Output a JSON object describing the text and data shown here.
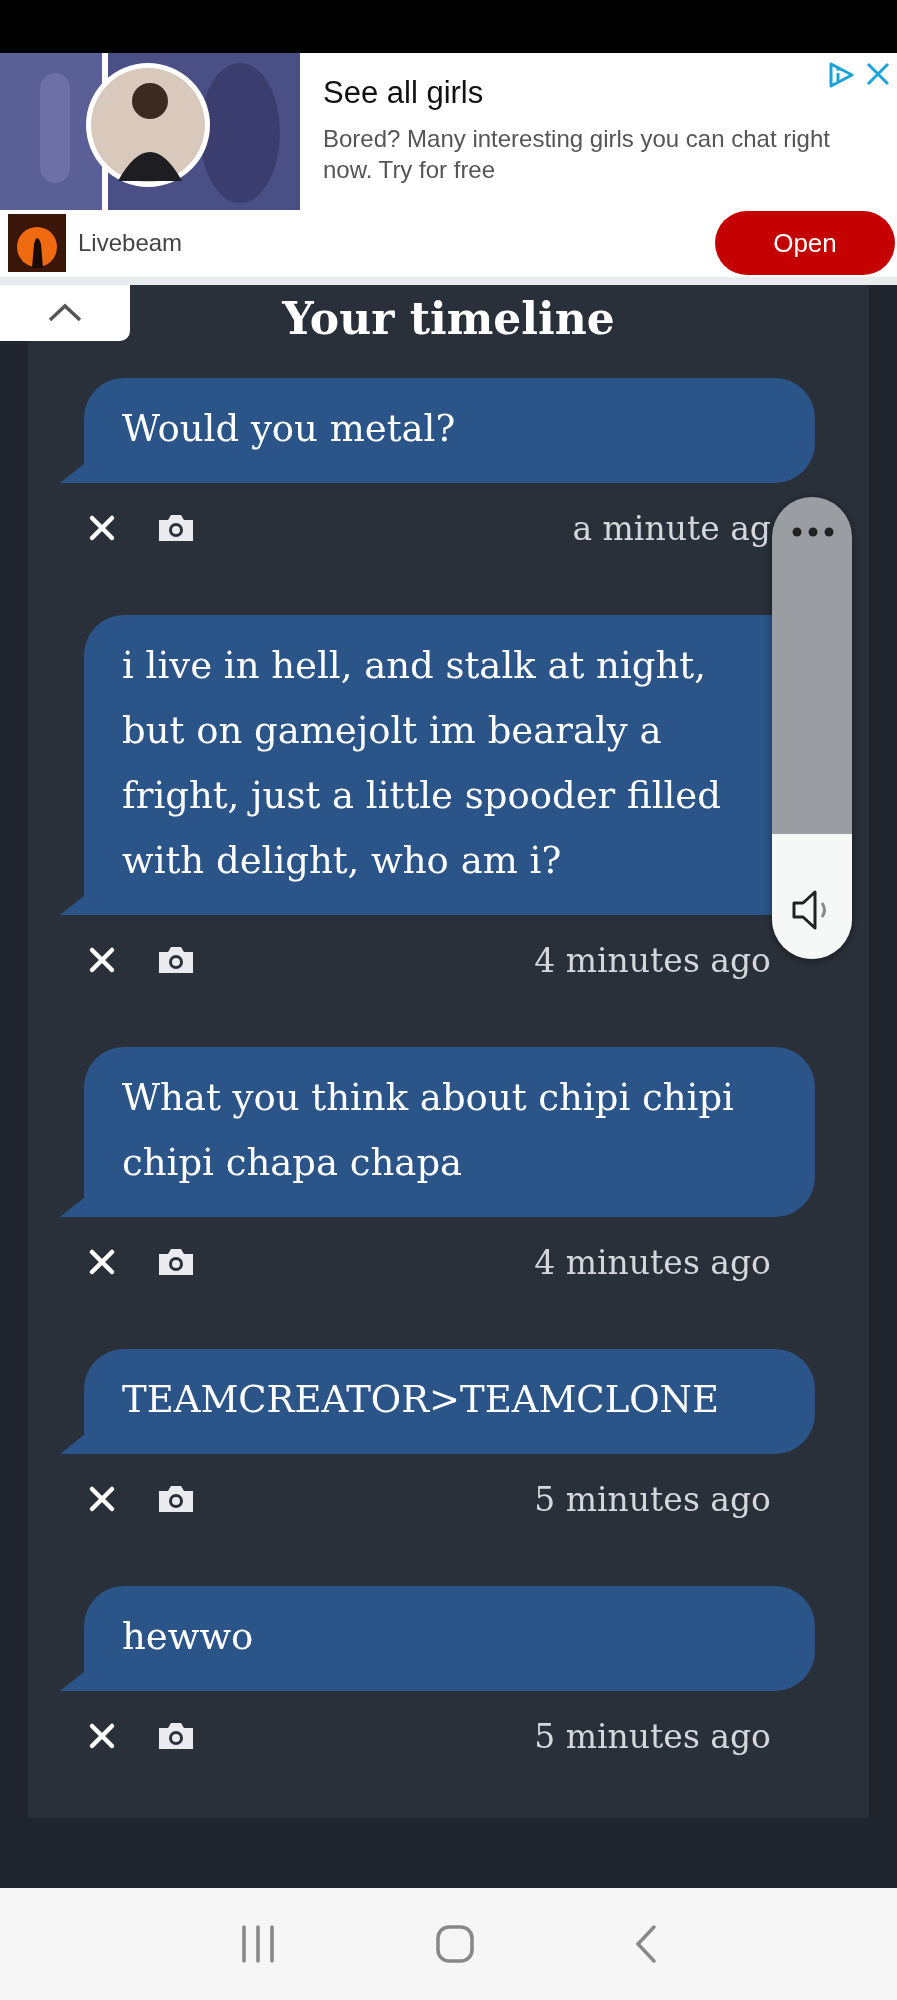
{
  "ad": {
    "title": "See all girls",
    "description": "Bored? Many interesting girls you can chat right now. Try for free",
    "advertiser": "Livebeam",
    "button": "Open"
  },
  "timeline": {
    "title": "Your timeline",
    "messages": [
      {
        "text": "Would you metal?",
        "time": "a minute ag"
      },
      {
        "text": "i live in hell, and stalk at night, but on gamejolt im bearaly a fright, just a little spooder filled with delight, who am i?",
        "time": "4 minutes ago"
      },
      {
        "text": "What you think about chipi chipi chipi chapa chapa",
        "time": "4 minutes ago"
      },
      {
        "text": "TEAMCREATOR>TEAMCLONE",
        "time": "5 minutes ago"
      },
      {
        "text": "hewwo",
        "time": "5 minutes ago"
      }
    ]
  },
  "volume": {
    "level": 0.27
  }
}
